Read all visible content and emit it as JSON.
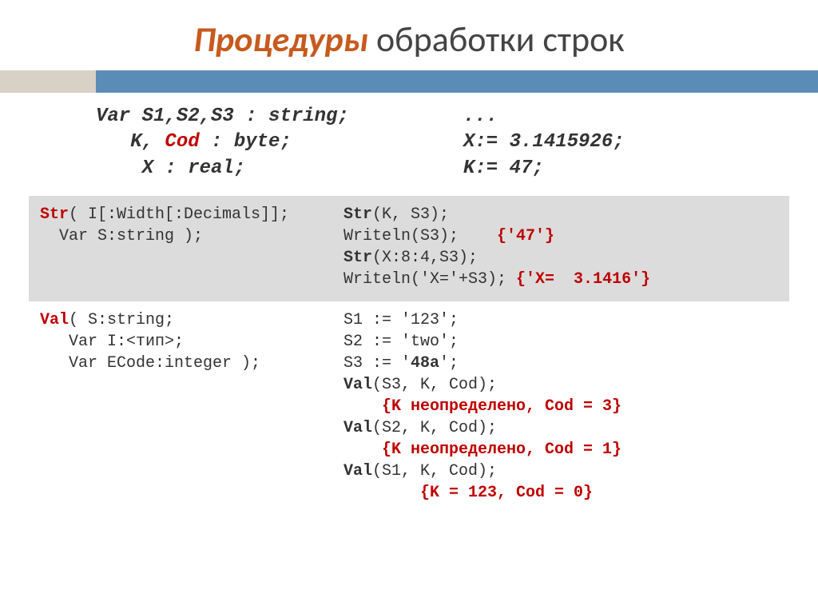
{
  "title": {
    "accent": "Процедуры",
    "rest": " обработки строк"
  },
  "decl": {
    "left": {
      "l1": "Var S1,S2,S3 : string;",
      "l2_a": "   K, ",
      "l2_cod": "Cod",
      "l2_b": " : byte;",
      "l3": "    X : real;"
    },
    "right": {
      "l1": "...",
      "l2": "X:= 3.1415926;",
      "l3": "K:= 47;"
    }
  },
  "rows": {
    "r1": {
      "left": {
        "l1_fn": "Str",
        "l1_rest": "( I[:Width[:Decimals]];",
        "l2": "  Var S:string );"
      },
      "right": {
        "l1_fn": "Str",
        "l1_rest": "(K, S3);",
        "l2_a": "Writeln(S3);    ",
        "l2_cm": "{'47'}",
        "l3_fn": "Str",
        "l3_rest": "(X:8:4,S3);",
        "l4_a": "Writeln('X='+S3); ",
        "l4_cm": "{'X=  3.1416'}"
      }
    },
    "r2": {
      "left": {
        "l1_fn": "Val",
        "l1_rest": "( S:string;",
        "l2": "   Var I:<тип>;",
        "l3": "   Var ECode:integer );"
      },
      "right": {
        "l1": "S1 := '123';",
        "l2": "S2 := 'two';",
        "l3_a": "S3 := '",
        "l3_b": "48a",
        "l3_c": "';",
        "l4_fn": "Val",
        "l4_rest": "(S3, K, Cod);",
        "l5_cm": "{K неопределено, Cod = 3}",
        "l6_fn": "Val",
        "l6_rest": "(S2, K, Cod);",
        "l7_cm": "{K неопределено, Cod = 1}",
        "l8_fn": "Val",
        "l8_rest": "(S1, K, Cod);",
        "l9_cm": "{K = 123, Cod = 0}"
      }
    }
  }
}
